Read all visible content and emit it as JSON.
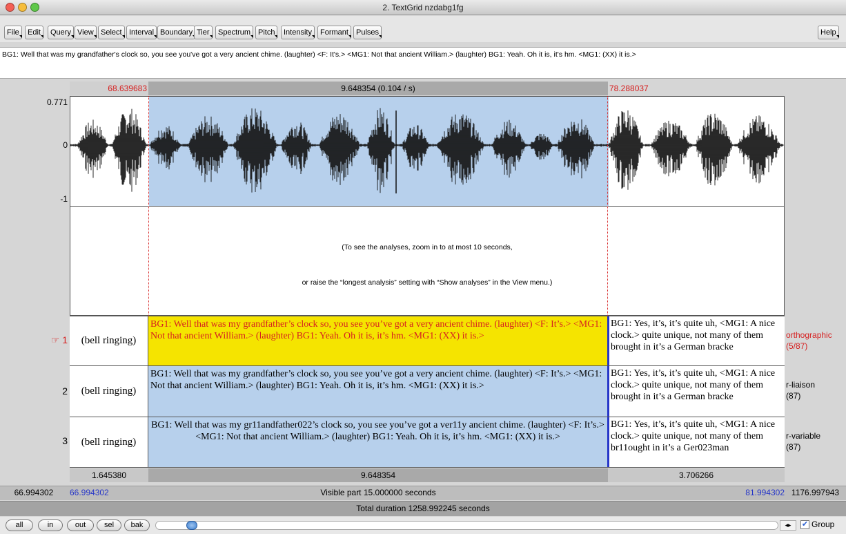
{
  "window": {
    "title": "2. TextGrid nzdabg1fg"
  },
  "menus": [
    "File",
    "Edit",
    "Query",
    "View",
    "Select",
    "Interval",
    "Boundary",
    "Tier",
    "Spectrum",
    "Pitch",
    "Intensity",
    "Formant",
    "Pulses"
  ],
  "help_label": "Help",
  "text_entry": {
    "value": "BG1: Well that was my grandfather's clock so, you see you've got a very ancient chime. (laughter) <F: It's.> <MG1: Not that ancient William.> (laughter) BG1: Yeah. Oh it is, it's hm. <MG1: (XX) it is.>"
  },
  "time_header": {
    "left": "68.639683",
    "center": "9.648354 (0.104 / s)",
    "right": "78.288037"
  },
  "waveform": {
    "y_max": "0.771",
    "y_zero": "0",
    "y_min": "-1"
  },
  "analysis_message": {
    "line1": "(To see the analyses, zoom in to at most 10 seconds,",
    "line2": "or raise the “longest analysis” setting with “Show analyses” in the View menu.)"
  },
  "tiers": [
    {
      "num": "1",
      "marker": "☞",
      "left": "(bell ringing)",
      "mid": "BG1: Well that was my grandfather’s clock so, you see you’ve got a very ancient chime. (laughter) <F: It’s.> <MG1: Not that ancient William.> (laughter) BG1: Yeah. Oh it is, it’s hm. <MG1: (XX) it is.>",
      "right": "BG1: Yes, it’s, it’s quite uh, <MG1: A nice clock.> quite unique, not many of them brought in it’s a German bracke",
      "name": "orthographic",
      "count": "(5/87)"
    },
    {
      "num": "2",
      "marker": "",
      "left": "(bell ringing)",
      "mid": "BG1: Well that was my grandfather’s clock so, you see you’ve got a very ancient chime. (laughter) <F: It’s.> <MG1: Not that ancient William.> (laughter) BG1: Yeah. Oh it is, it’s hm. <MG1: (XX) it is.>",
      "right": "BG1: Yes, it’s, it’s quite uh, <MG1: A nice clock.> quite unique, not many of them brought in it’s a German bracke",
      "name": "r-liaison",
      "count": "(87)"
    },
    {
      "num": "3",
      "marker": "",
      "left": "(bell ringing)",
      "mid": "BG1: Well that was my gr11andfather022’s clock so, you see you’ve got a ver11y ancient chime. (laughter) <F: It’s.> <MG1: Not that ancient William.> (laughter) BG1: Yeah. Oh it is, it’s hm. <MG1: (XX) it is.>",
      "right": "BG1: Yes, it’s, it’s quite uh, <MG1: A nice clock.> quite unique, not many of them br11ought in it’s a Ger023man",
      "name": "r-variable",
      "count": "(87)"
    }
  ],
  "durations": {
    "left": "1.645380",
    "center": "9.648354",
    "right": "3.706266"
  },
  "visible_bar": {
    "start_outer": "66.994302",
    "start": "66.994302",
    "label": "Visible part 15.000000 seconds",
    "end": "81.994302",
    "end_outer": "1176.997943"
  },
  "total_bar": {
    "label": "Total duration 1258.992245 seconds"
  },
  "buttons": {
    "all": "all",
    "in": "in",
    "out": "out",
    "sel": "sel",
    "bak": "bak"
  },
  "group": {
    "label": "Group",
    "checked": true
  },
  "colors": {
    "selection": "#b7d0ec",
    "highlight": "#f5e400",
    "cursor_red": "#d62020",
    "boundary_blue": "#2535c8"
  }
}
